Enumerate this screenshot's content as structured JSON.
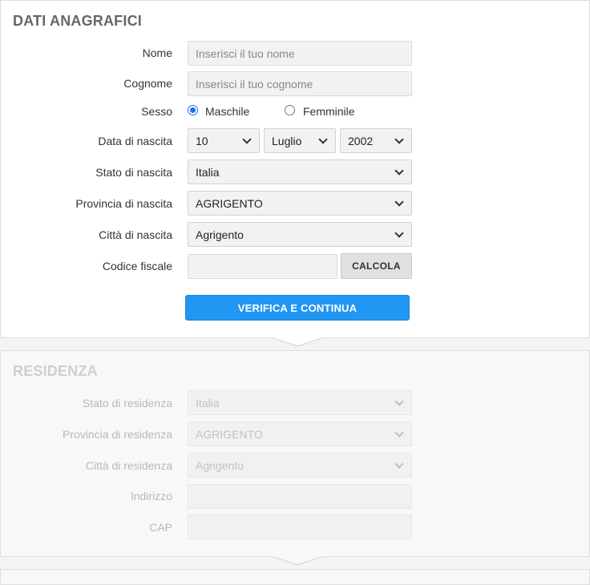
{
  "anagrafici": {
    "title": "DATI ANAGRAFICI",
    "nome": {
      "label": "Nome",
      "placeholder": "Inserisci il tuo nome",
      "value": ""
    },
    "cognome": {
      "label": "Cognome",
      "placeholder": "Inserisci il tuo cognome",
      "value": ""
    },
    "sesso": {
      "label": "Sesso",
      "options": [
        "Maschile",
        "Femminile"
      ],
      "selected": "Maschile"
    },
    "data_nascita": {
      "label": "Data di nascita",
      "day": "10",
      "month": "Luglio",
      "year": "2002"
    },
    "stato_nascita": {
      "label": "Stato di nascita",
      "value": "Italia"
    },
    "provincia_nascita": {
      "label": "Provincia di nascita",
      "value": "AGRIGENTO"
    },
    "citta_nascita": {
      "label": "Città di nascita",
      "value": "Agrigento"
    },
    "codice_fiscale": {
      "label": "Codice fiscale",
      "value": ""
    },
    "calcola_label": "CALCOLA",
    "verifica_label": "VERIFICA E CONTINUA"
  },
  "residenza": {
    "title": "RESIDENZA",
    "stato": {
      "label": "Stato di residenza",
      "value": "Italia"
    },
    "provincia": {
      "label": "Provincia di residenza",
      "value": "AGRIGENTO"
    },
    "citta": {
      "label": "Città di residenza",
      "value": "Agrigento"
    },
    "indirizzo": {
      "label": "Indirizzo",
      "value": ""
    },
    "cap": {
      "label": "CAP",
      "value": ""
    }
  },
  "colors": {
    "accent": "#2196f3",
    "radio_selected": "#1a73e8",
    "field_bg": "#f2f2f2",
    "disabled_text": "#c2c2c2"
  },
  "icons": {
    "select_arrow": "chevron-down-icon"
  }
}
